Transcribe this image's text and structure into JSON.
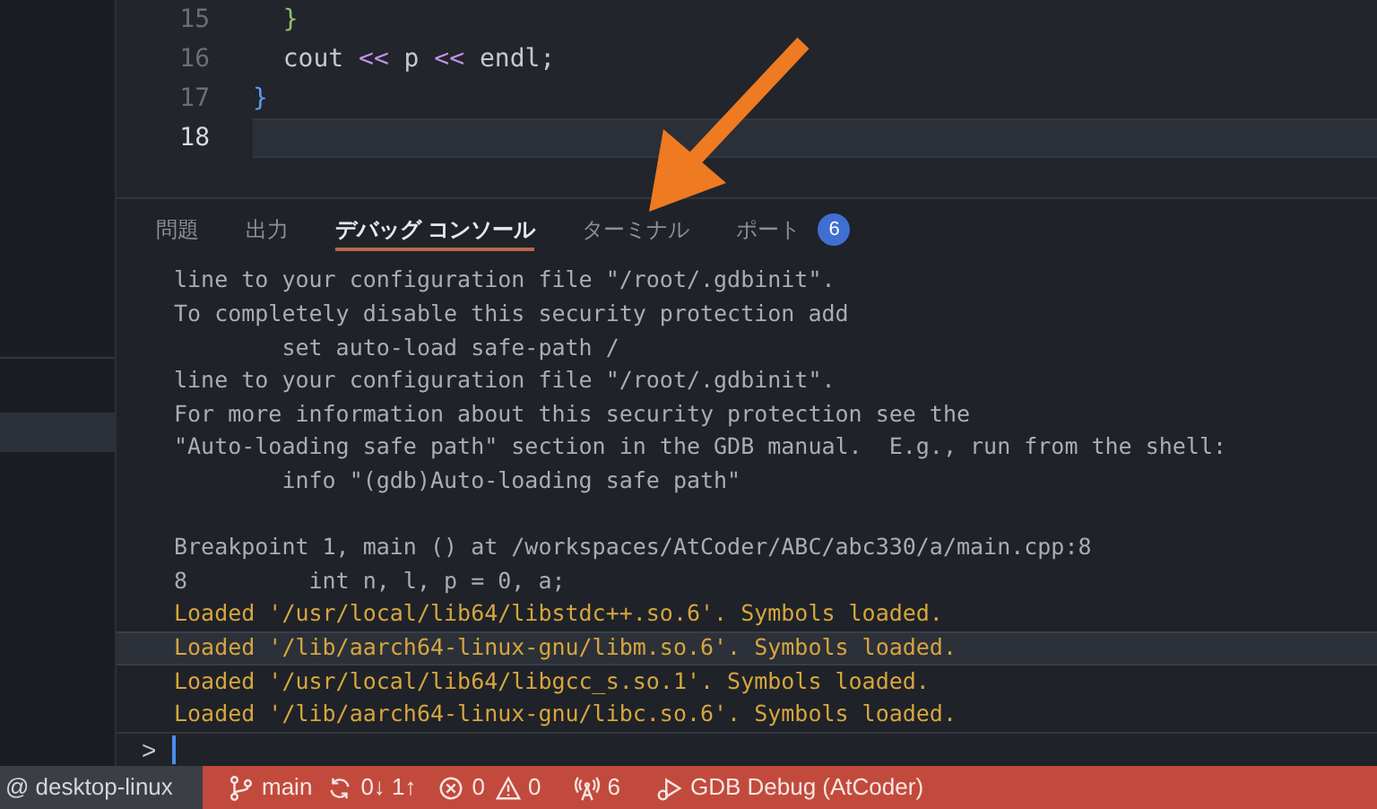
{
  "editor": {
    "lines": [
      {
        "number": "15",
        "current": false,
        "tokens": [
          {
            "text": "  }",
            "kind": "brace-green"
          }
        ]
      },
      {
        "number": "16",
        "current": false,
        "tokens": [
          {
            "text": "  cout ",
            "kind": "plain"
          },
          {
            "text": "<<",
            "kind": "operator"
          },
          {
            "text": " p ",
            "kind": "plain"
          },
          {
            "text": "<<",
            "kind": "operator"
          },
          {
            "text": " endl;",
            "kind": "plain"
          }
        ]
      },
      {
        "number": "17",
        "current": false,
        "tokens": [
          {
            "text": "}",
            "kind": "brace-blue"
          }
        ]
      },
      {
        "number": "18",
        "current": true
      }
    ]
  },
  "panel": {
    "tabs": [
      {
        "label": "問題",
        "selected": false
      },
      {
        "label": "出力",
        "selected": false
      },
      {
        "label": "デバッグ コンソール",
        "selected": true
      },
      {
        "label": "ターミナル",
        "selected": false
      },
      {
        "label": "ポート",
        "selected": false,
        "badge": "6"
      }
    ],
    "console": [
      {
        "lines": [
          {
            "kind": "info",
            "text": "line to your configuration file \"/root/.gdbinit\".",
            "highlighted": false
          },
          {
            "kind": "info",
            "text": "To completely disable this security protection add",
            "highlighted": false
          },
          {
            "kind": "info",
            "text": "        set auto-load safe-path /",
            "highlighted": false
          },
          {
            "kind": "info",
            "text": "line to your configuration file \"/root/.gdbinit\".",
            "highlighted": false
          },
          {
            "kind": "info",
            "text": "For more information about this security protection see the",
            "highlighted": false
          },
          {
            "kind": "info",
            "text": "\"Auto-loading safe path\" section in the GDB manual.  E.g., run from the shell:",
            "highlighted": false
          },
          {
            "kind": "info",
            "text": "        info \"(gdb)Auto-loading safe path\"",
            "highlighted": false
          }
        ]
      },
      {
        "lines": [
          {
            "kind": "info",
            "text": "Breakpoint 1, main () at /workspaces/AtCoder/ABC/abc330/a/main.cpp:8",
            "highlighted": false
          },
          {
            "kind": "info",
            "text": "8         int n, l, p = 0, a;",
            "highlighted": false
          },
          {
            "kind": "loaded",
            "text": "Loaded '/usr/local/lib64/libstdc++.so.6'. Symbols loaded.",
            "highlighted": false
          },
          {
            "kind": "loaded",
            "text": "Loaded '/lib/aarch64-linux-gnu/libm.so.6'. Symbols loaded.",
            "highlighted": true
          },
          {
            "kind": "loaded",
            "text": "Loaded '/usr/local/lib64/libgcc_s.so.1'. Symbols loaded.",
            "highlighted": false
          },
          {
            "kind": "loaded",
            "text": "Loaded '/lib/aarch64-linux-gnu/libc.so.6'. Symbols loaded.",
            "highlighted": false
          }
        ]
      }
    ],
    "prompt": ">"
  },
  "status_bar": {
    "remote": "@ desktop-linux",
    "items": [
      {
        "kind": "branch",
        "text": "main"
      },
      {
        "kind": "sync",
        "text": "0↓ 1↑"
      },
      {
        "kind": "errors",
        "text": "0"
      },
      {
        "kind": "warnings",
        "text": "0"
      },
      {
        "kind": "ports",
        "text": "6"
      },
      {
        "kind": "debug",
        "text": "GDB Debug (AtCoder)"
      }
    ]
  }
}
